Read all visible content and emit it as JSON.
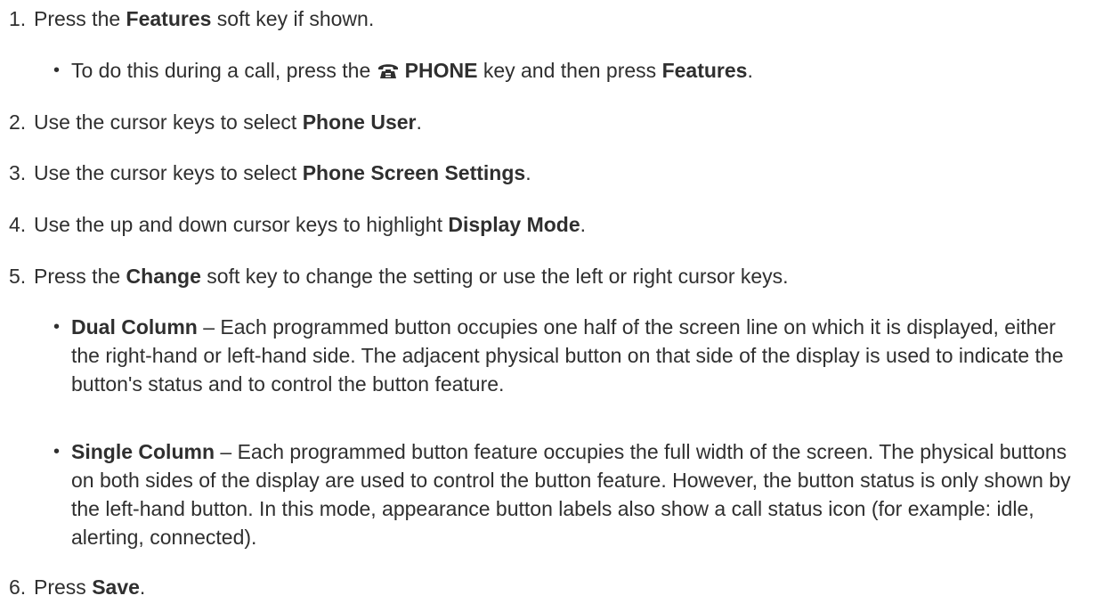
{
  "steps": [
    {
      "num": "1.",
      "pre": "Press the ",
      "bold": "Features",
      "post": " soft key if shown."
    },
    {
      "num": "2.",
      "pre": "Use the cursor keys to select ",
      "bold": "Phone User",
      "post": "."
    },
    {
      "num": "3.",
      "pre": "Use the cursor keys to select ",
      "bold": "Phone Screen Settings",
      "post": "."
    },
    {
      "num": "4.",
      "pre": "Use the up and down cursor keys to highlight ",
      "bold": "Display Mode",
      "post": "."
    },
    {
      "num": "5.",
      "pre": "Press the ",
      "bold": "Change",
      "post": " soft key to change the setting or use the left or right cursor keys."
    },
    {
      "num": "6.",
      "pre": "Press ",
      "bold": "Save",
      "post": "."
    }
  ],
  "step1_sub": {
    "bullet": "•",
    "pre": "To do this during a call, press the ",
    "icon": "phone-icon",
    "bold1": "PHONE",
    "mid": " key and then press ",
    "bold2": "Features",
    "post": "."
  },
  "step5_subs": [
    {
      "bullet": "•",
      "bold": "Dual Column",
      "text": " – Each programmed button occupies one half of the screen line on which it is displayed, either the right-hand or left-hand side. The adjacent physical button on that side of the display is used to indicate the button's status and to control the button feature."
    },
    {
      "bullet": "•",
      "bold": "Single Column",
      "text": " – Each programmed button feature occupies the full width of the screen. The physical buttons on both sides of the display are used to control the button feature. However, the button status is only shown by the left-hand button. In this mode, appearance button labels also show a call status icon (for example: idle, alerting, connected)."
    }
  ]
}
